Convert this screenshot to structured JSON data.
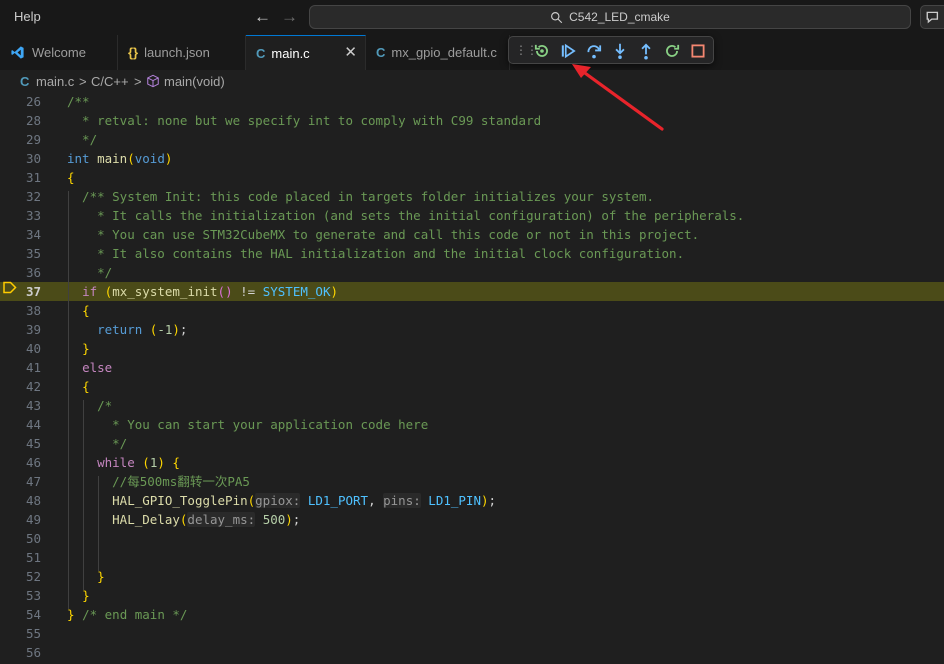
{
  "titlebar": {
    "menu": "Help",
    "back_icon": "arrow-left-icon",
    "forward_icon": "arrow-right-icon",
    "search": "C542_LED_cmake"
  },
  "tabs": [
    {
      "label": "Welcome",
      "icon": "vscode-logo-icon"
    },
    {
      "label": "launch.json",
      "icon": "{}"
    },
    {
      "label": "main.c",
      "icon": "C",
      "active": true
    },
    {
      "label": "mx_gpio_default.c",
      "icon": "C"
    }
  ],
  "debug_toolbar": [
    "drag-handle",
    "restart-icon",
    "continue-icon",
    "step-over-icon",
    "step-into-icon",
    "step-out-icon",
    "restart-session-icon",
    "stop-icon"
  ],
  "breadcrumb": {
    "file": "main.c",
    "sep1": ">",
    "folder": "C/C++",
    "sep2": ">",
    "symbol": "main(void)"
  },
  "editor": {
    "current_line": "37",
    "lines": [
      {
        "n": "26",
        "t": "/**"
      },
      {
        "n": "28",
        "t": "  * retval: none but we specify int to comply with C99 standard"
      },
      {
        "n": "29",
        "t": "  */"
      },
      {
        "n": "30",
        "t": "int main(void)"
      },
      {
        "n": "31",
        "t": "{"
      },
      {
        "n": "32",
        "t": "  /** System Init: this code placed in targets folder initializes your system."
      },
      {
        "n": "33",
        "t": "    * It calls the initialization (and sets the initial configuration) of the peripherals."
      },
      {
        "n": "34",
        "t": "    * You can use STM32CubeMX to generate and call this code or not in this project."
      },
      {
        "n": "35",
        "t": "    * It also contains the HAL initialization and the initial clock configuration."
      },
      {
        "n": "36",
        "t": "    */"
      },
      {
        "n": "37",
        "t": "  if (mx_system_init() != SYSTEM_OK)"
      },
      {
        "n": "38",
        "t": "  {"
      },
      {
        "n": "39",
        "t": "    return (-1);"
      },
      {
        "n": "40",
        "t": "  }"
      },
      {
        "n": "41",
        "t": "  else"
      },
      {
        "n": "42",
        "t": "  {"
      },
      {
        "n": "43",
        "t": "    /*"
      },
      {
        "n": "44",
        "t": "      * You can start your application code here"
      },
      {
        "n": "45",
        "t": "      */"
      },
      {
        "n": "46",
        "t": "    while (1) {"
      },
      {
        "n": "47",
        "t": "      //每500ms翻转一次PA5"
      },
      {
        "n": "48",
        "t": "      HAL_GPIO_TogglePin(gpiox: LD1_PORT, pins: LD1_PIN);"
      },
      {
        "n": "49",
        "t": "      HAL_Delay(delay_ms: 500);"
      },
      {
        "n": "50",
        "t": ""
      },
      {
        "n": "51",
        "t": ""
      },
      {
        "n": "52",
        "t": "    }"
      },
      {
        "n": "53",
        "t": "  }"
      },
      {
        "n": "54",
        "t": "} /* end main */"
      },
      {
        "n": "55",
        "t": ""
      },
      {
        "n": "56",
        "t": ""
      }
    ]
  },
  "colors": {
    "accent": "#0078d4",
    "highlight_line": "#4b4b18",
    "annotation_arrow": "#e8242b"
  }
}
